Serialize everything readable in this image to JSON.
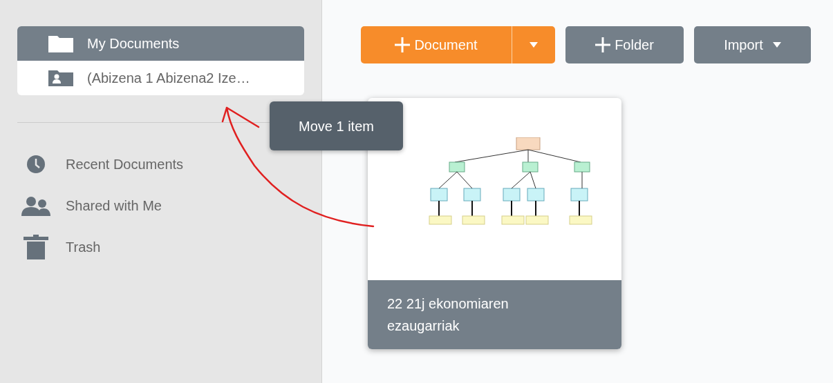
{
  "sidebar": {
    "folders": [
      {
        "label": "My Documents",
        "kind": "folder",
        "selected": true,
        "children": [
          {
            "label": "(Abizena 1 Abizena2 Ize…",
            "kind": "shared-folder",
            "selected": false,
            "drop_target": true
          }
        ]
      }
    ],
    "nav": [
      {
        "label": "Recent Documents",
        "kind": "recent"
      },
      {
        "label": "Shared with Me",
        "kind": "shared"
      },
      {
        "label": "Trash",
        "kind": "trash"
      }
    ]
  },
  "toolbar": {
    "new_document": "Document",
    "new_folder": "Folder",
    "import": "Import"
  },
  "tooltip": "Move 1 item",
  "documents": [
    {
      "title": "22 21j ekonomiaren ezaugarriak"
    }
  ]
}
